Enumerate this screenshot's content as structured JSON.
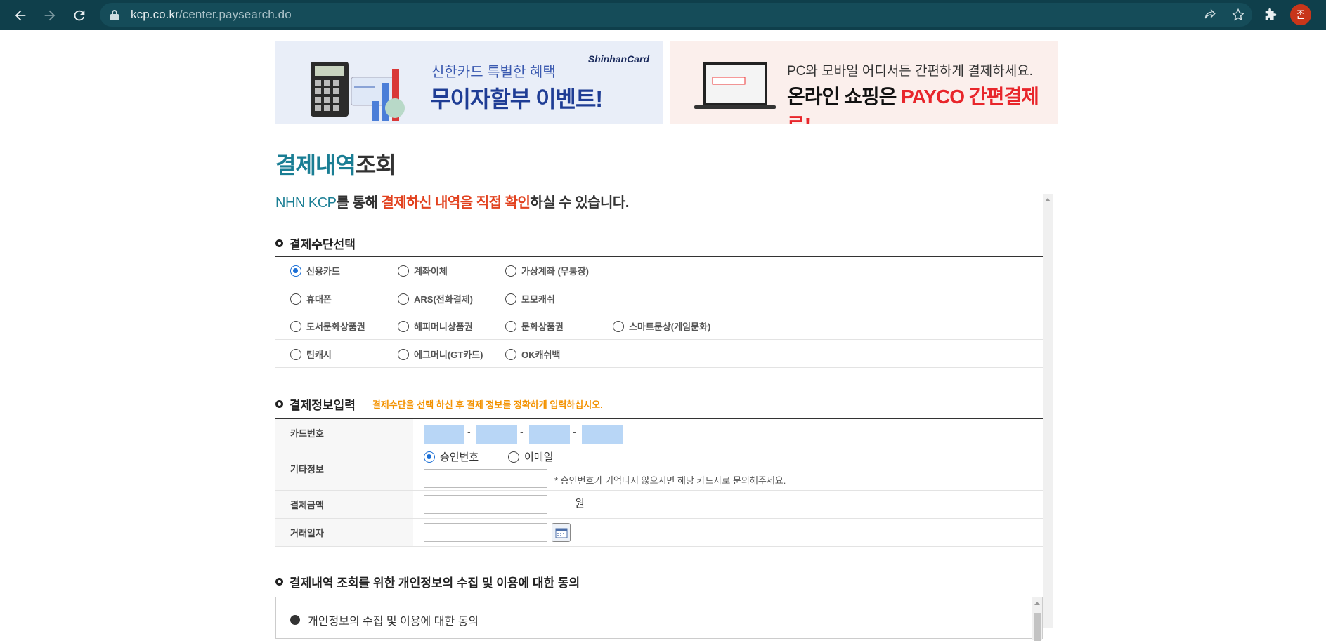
{
  "browser": {
    "url_host": "kcp.co.kr",
    "url_path": "/center.paysearch.do",
    "profile_initial": "존"
  },
  "banners": {
    "left": {
      "subtitle": "신한카드 특별한 혜택",
      "title": "무이자할부 이벤트!",
      "logo": "ShinhanCard"
    },
    "right": {
      "subtitle": "PC와 모바일 어디서든 간편하게 결제하세요.",
      "title_prefix": "온라인 쇼핑은 ",
      "title_highlight": "PAYCO 간편결제로!"
    }
  },
  "page": {
    "title_highlight": "결제내역",
    "title_rest": "조회",
    "lead_brand": "NHN KCP",
    "lead_part1": "를 통해 ",
    "lead_red": "결제하신 내역을 직접 확인",
    "lead_part2": "하실 수 있습니다."
  },
  "method_section": {
    "heading": "결제수단선택",
    "rows": [
      [
        "신용카드",
        "계좌이체",
        "가상계좌 (무통장)"
      ],
      [
        "휴대폰",
        "ARS(전화결제)",
        "모모캐쉬"
      ],
      [
        "도서문화상품권",
        "해피머니상품권",
        "문화상품권",
        "스마트문상(게임문화)"
      ],
      [
        "틴캐시",
        "에그머니(GT카드)",
        "OK캐쉬백"
      ]
    ],
    "selected": "신용카드"
  },
  "info_section": {
    "heading": "결제정보입력",
    "note": "결제수단을 선택 하신 후 결제 정보를 정확하게 입력하십시오.",
    "card_label": "카드번호",
    "card_separator": "-",
    "other_label": "기타정보",
    "opt_approval": "승인번호",
    "opt_email": "이메일",
    "approval_hint": "* 승인번호가 기억나지 않으시면 해당 카드사로 문의해주세요.",
    "amount_label": "결제금액",
    "amount_unit": "원",
    "date_label": "거래일자"
  },
  "consent_section": {
    "heading": "결제내역 조회를 위한 개인정보의 수집 및 이용에 대한 동의",
    "item": "개인정보의 수집 및 이용에 대한 동의"
  },
  "colors": {
    "chrome": "#0f3f4b",
    "brand_teal": "#1a7e94",
    "accent_red": "#e2421f",
    "note_orange": "#f39200",
    "card_field": "#b8d6f6"
  }
}
